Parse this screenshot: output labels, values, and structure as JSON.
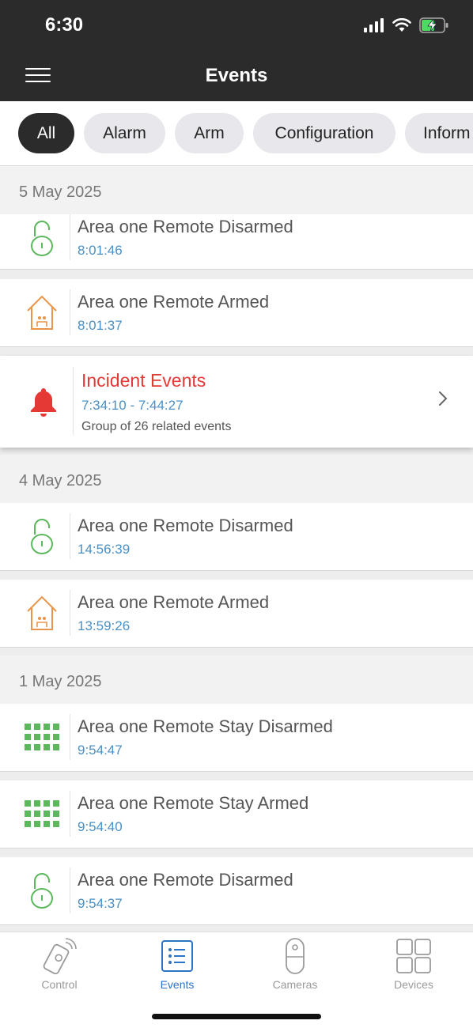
{
  "status": {
    "time": "6:30"
  },
  "nav": {
    "title": "Events"
  },
  "filters": [
    "All",
    "Alarm",
    "Arm",
    "Configuration",
    "Inform"
  ],
  "groups": [
    {
      "date": "5 May 2025",
      "items": [
        {
          "icon": "unlock-icon",
          "title": "Area one Remote Disarmed",
          "time": "8:01:46"
        },
        {
          "icon": "house-armed-icon",
          "title": "Area one Remote Armed",
          "time": "8:01:37"
        }
      ],
      "incident": {
        "title": "Incident Events",
        "time": "7:34:10 - 7:44:27",
        "subtitle": "Group of 26 related events"
      }
    },
    {
      "date": "4 May 2025",
      "items": [
        {
          "icon": "unlock-icon",
          "title": "Area one Remote Disarmed",
          "time": "14:56:39"
        },
        {
          "icon": "house-armed-icon",
          "title": "Area one Remote Armed",
          "time": "13:59:26"
        }
      ]
    },
    {
      "date": "1 May 2025",
      "items": [
        {
          "icon": "keypad-icon",
          "title": "Area one Remote Stay Disarmed",
          "time": "9:54:47"
        },
        {
          "icon": "keypad-icon",
          "title": "Area one Remote Stay Armed",
          "time": "9:54:40"
        },
        {
          "icon": "unlock-icon",
          "title": "Area one Remote Disarmed",
          "time": "9:54:37"
        }
      ]
    }
  ],
  "tabs": [
    {
      "label": "Control",
      "icon": "remote-control-icon"
    },
    {
      "label": "Events",
      "icon": "events-list-icon"
    },
    {
      "label": "Cameras",
      "icon": "camera-icon"
    },
    {
      "label": "Devices",
      "icon": "devices-grid-icon"
    }
  ],
  "colors": {
    "header": "#2b2b2b",
    "accent": "#2a73c5",
    "disarm": "#5cb85c",
    "arm": "#e8954a",
    "alarm": "#e53935"
  }
}
